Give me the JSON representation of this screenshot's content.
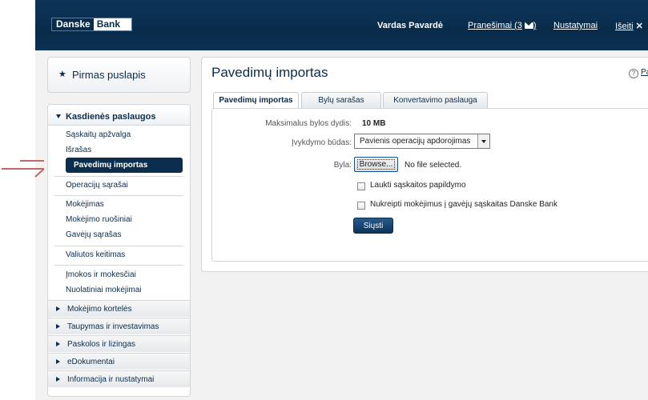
{
  "header": {
    "logo_danske": "Danske",
    "logo_bank": "Bank",
    "user_name": "Vardas Pavardė",
    "messages_label": "Pranešimai (3",
    "messages_suffix": ")",
    "settings_label": "Nustatymai",
    "logout_label": "Išeiti",
    "logout_icon": "✕"
  },
  "sidebar": {
    "home_icon": "★",
    "home_label": "Pirmas puslapis",
    "section_title": "Kasdienės paslaugos",
    "items": [
      "Sąskaitų apžvalga",
      "Išrašas",
      "Pavedimų importas",
      "Operacijų sąrašai",
      "Mokėjimas",
      "Mokėjimo ruošiniai",
      "Gavėjų sąrašas",
      "Valiutos keitimas",
      "Įmokos ir mokesčiai",
      "Nuolatiniai mokėjimai"
    ],
    "active_item": "Pavedimų importas",
    "categories": [
      "Mokėjimo kortelės",
      "Taupymas ir investavimas",
      "Paskolos ir lizingas",
      "eDokumentai",
      "Informacija ir nustatymai"
    ]
  },
  "main": {
    "title": "Pavedimų importas",
    "help_label": "Pagalba",
    "tabs": [
      {
        "label": "Pavedimų importas",
        "active": true
      },
      {
        "label": "Bylų sarašas",
        "active": false
      },
      {
        "label": "Konvertavimo paslauga",
        "active": false
      }
    ],
    "form": {
      "max_size_label": "Maksimalus bylos dydis:",
      "max_size_value": "10 MB",
      "mode_label": "Įvykdymo būdas:",
      "mode_value": "Pavienis operacijų apdorojimas",
      "file_label": "Byla:",
      "browse_label": "Browse...",
      "no_file_text": "No file selected.",
      "checkbox1_label": "Laukti sąskaitos papildymo",
      "checkbox2_label": "Nukreipti mokėjimus į gavėjų sąskaitas Danske Bank",
      "submit_label": "Siųsti"
    }
  },
  "colors": {
    "brand": "#0a2c4b",
    "active": "#0b2e4e",
    "pointer": "#c0686a"
  }
}
